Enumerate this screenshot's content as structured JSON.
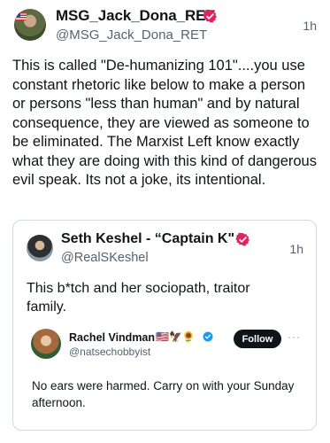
{
  "post": {
    "author_name": "MSG_Jack_Dona_RET",
    "author_handle": "@MSG_Jack_Dona_RET",
    "time": "1h",
    "body": "This is called \"De-humanizing 101\"....you use constant rhetoric like below to make a person or persons \"less than human\" and by natural consequence, they are viewed as someone to be eliminated. The Marxist Left know exactly what they are doing with this kind of dangerous evil speak. Its not a joke, its intentional."
  },
  "quote": {
    "author_name": "Seth Keshel - “Captain K\"",
    "author_handle": "@RealSKeshel",
    "time": "1h",
    "body": "This b*tch and her sociopath, traitor family."
  },
  "embedded": {
    "author_name": "Rachel Vindman",
    "name_emojis": "🇺🇸🦅🌻",
    "author_handle": "@natsechobbyist",
    "follow_label": "Follow",
    "more_label": "···",
    "body": "No ears were harmed. Carry on with your Sunday afternoon."
  },
  "colors": {
    "verified_badge": "#e0245e",
    "verified_blue": "#1d9bf0",
    "secondary_text": "#536471",
    "border": "#cfd9de"
  },
  "icons": {
    "verified": "verified-badge-icon",
    "more": "more-dots-icon"
  }
}
